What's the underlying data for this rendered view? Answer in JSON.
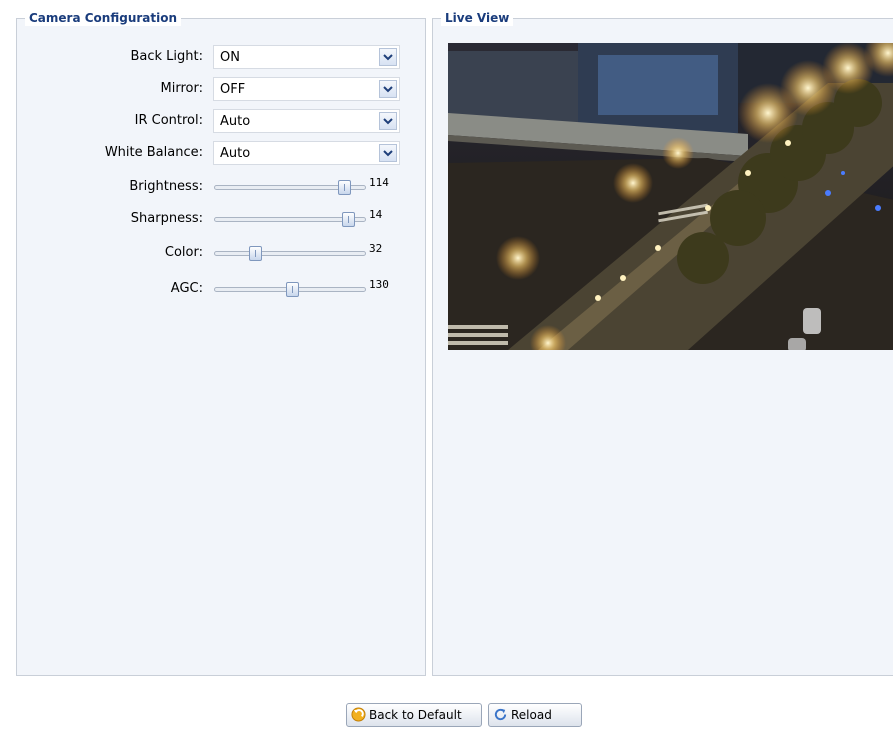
{
  "camera_config": {
    "legend": "Camera Configuration",
    "selects": [
      {
        "label": "Back Light:",
        "value": "ON"
      },
      {
        "label": "Mirror:",
        "value": "OFF"
      },
      {
        "label": "IR Control:",
        "value": "Auto"
      },
      {
        "label": "White Balance:",
        "value": "Auto"
      }
    ],
    "sliders": [
      {
        "label": "Brightness:",
        "value": "114",
        "level": 0.9
      },
      {
        "label": "Sharpness:",
        "value": "14",
        "level": 0.93
      },
      {
        "label": "Color:",
        "value": "32",
        "level": 0.25
      },
      {
        "label": "AGC:",
        "value": "130",
        "level": 0.52
      }
    ]
  },
  "live_view": {
    "legend": "Live View"
  },
  "buttons": {
    "back_to_default": "Back to Default",
    "reload": "Reload"
  },
  "icons": {
    "dropdown": "chevron-down-icon",
    "back_to_default": "undo-arrow-icon",
    "reload": "refresh-icon"
  },
  "colors": {
    "legend_text": "#1a3c7c",
    "panel_bg": "#f2f5fa",
    "panel_border": "#c9cfd8"
  }
}
